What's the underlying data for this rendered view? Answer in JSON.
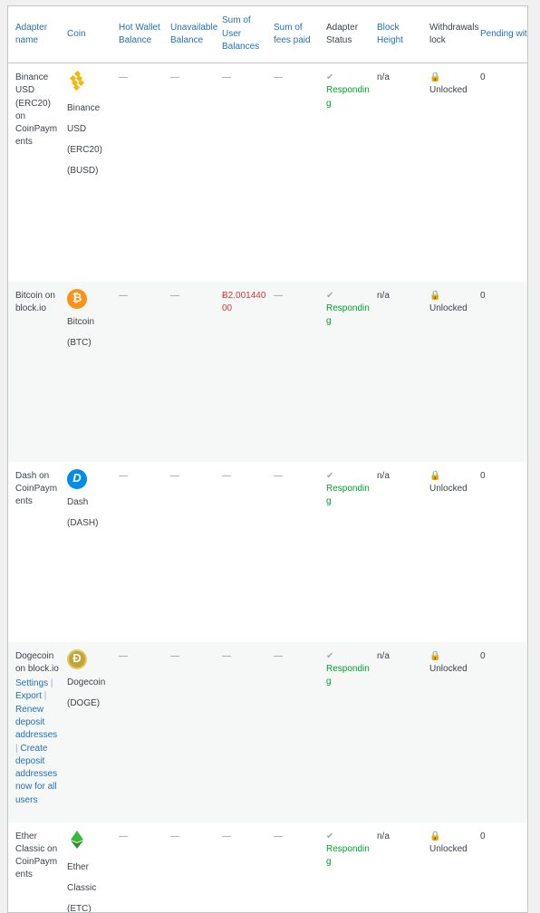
{
  "headers": {
    "adapter_name": "Adapter name",
    "coin": "Coin",
    "hot_wallet_balance": "Hot Wallet Balance",
    "unavailable_balance": "Unavailable Balance",
    "sum_user_balances": "Sum of User Balances",
    "sum_fees_paid": "Sum of fees paid",
    "adapter_status": "Adapter Status",
    "block_height": "Block Height",
    "withdrawals_lock": "Withdrawals lock",
    "pending_withdrawals": "Pending withdrawals"
  },
  "rows": [
    {
      "adapter": "Binance USD (ERC20) on CoinPayments",
      "coin_name": "Binance USD (ERC20) (BUSD)",
      "icon": "busd-icon",
      "hot_wallet": "—",
      "unavailable": "—",
      "sum_users": "—",
      "fees": "—",
      "status_mark": "✔",
      "status": "Responding",
      "block_height": "n/a",
      "lock_icon": "🔒",
      "lock": "Unlocked",
      "pending": "0"
    },
    {
      "adapter": "Bitcoin on block.io",
      "coin_name": "Bitcoin (BTC)",
      "icon": "btc-icon",
      "hot_wallet": "—",
      "unavailable": "—",
      "sum_users": "Ƀ2.00144000",
      "fees": "—",
      "status_mark": "✔",
      "status": "Responding",
      "block_height": "n/a",
      "lock_icon": "🔒",
      "lock": "Unlocked",
      "pending": "0"
    },
    {
      "adapter": "Dash on CoinPayments",
      "coin_name": "Dash (DASH)",
      "icon": "dash-icon",
      "hot_wallet": "—",
      "unavailable": "—",
      "sum_users": "—",
      "fees": "—",
      "status_mark": "✔",
      "status": "Responding",
      "block_height": "n/a",
      "lock_icon": "🔒",
      "lock": "Unlocked",
      "pending": "0"
    },
    {
      "adapter": "Dogecoin on block.io",
      "links": [
        "Settings",
        "Export",
        "Renew deposit addresses",
        "Create deposit addresses now for all users"
      ],
      "coin_name": "Dogecoin (DOGE)",
      "icon": "doge-icon",
      "hot_wallet": "—",
      "unavailable": "—",
      "sum_users": "—",
      "fees": "—",
      "status_mark": "✔",
      "status": "Responding",
      "block_height": "n/a",
      "lock_icon": "🔒",
      "lock": "Unlocked",
      "pending": "0"
    },
    {
      "adapter": "Ether Classic on CoinPayments",
      "coin_name": "Ether Classic (ETC)",
      "icon": "etc-icon",
      "hot_wallet": "—",
      "unavailable": "—",
      "sum_users": "—",
      "fees": "—",
      "status_mark": "✔",
      "status": "Responding",
      "block_height": "n/a",
      "lock_icon": "🔒",
      "lock": "Unlocked",
      "pending": "0"
    }
  ],
  "colors": {
    "link": "#2271b1",
    "responding": "#00a32a",
    "negative": "#d63638",
    "busd": "#f0b90b",
    "btc": "#f7931a",
    "dash": "#008ce7",
    "doge": "#c2a633",
    "etc": "#3ab83a"
  }
}
